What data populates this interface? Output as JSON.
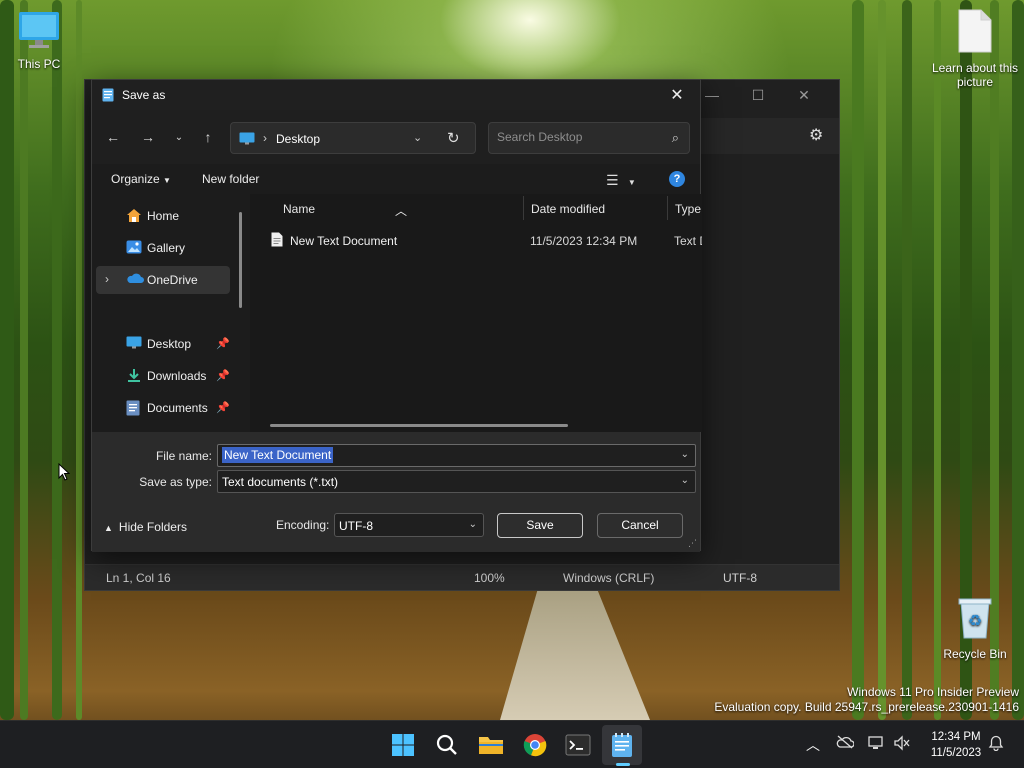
{
  "desktop": {
    "icons": [
      {
        "label": "This PC",
        "icon": "this-pc-icon"
      },
      {
        "label": "Learn about this picture",
        "icon": "text-file-icon"
      },
      {
        "label": "Recycle Bin",
        "icon": "recycle-bin-icon"
      }
    ],
    "watermark": {
      "line1": "Windows 11 Pro Insider Preview",
      "line2": "Evaluation copy. Build 25947.rs_prerelease.230901-1416"
    }
  },
  "notepad": {
    "status": {
      "position": "Ln 1, Col 16",
      "zoom": "100%",
      "line_endings": "Windows (CRLF)",
      "encoding": "UTF-8"
    }
  },
  "dialog": {
    "title": "Save as",
    "address": {
      "location": "Desktop"
    },
    "search": {
      "placeholder": "Search Desktop"
    },
    "commands": {
      "organize": "Organize",
      "new_folder": "New folder"
    },
    "nav": {
      "items": [
        {
          "label": "Home",
          "icon": "home-icon",
          "pinned": false
        },
        {
          "label": "Gallery",
          "icon": "gallery-icon",
          "pinned": false
        },
        {
          "label": "OneDrive",
          "icon": "onedrive-icon",
          "selected": true
        },
        {
          "label": "Desktop",
          "icon": "desktop-folder-icon",
          "pinned": true
        },
        {
          "label": "Downloads",
          "icon": "download-icon",
          "pinned": true
        },
        {
          "label": "Documents",
          "icon": "documents-icon",
          "pinned": true
        }
      ]
    },
    "columns": {
      "name": "Name",
      "date": "Date modified",
      "type": "Type"
    },
    "files": [
      {
        "name": "New Text Document",
        "date": "11/5/2023 12:34 PM",
        "type": "Text D"
      }
    ],
    "form": {
      "file_name_label": "File name:",
      "file_name_value": "New Text Document",
      "type_label": "Save as type:",
      "type_value": "Text documents (*.txt)",
      "hide_folders": "Hide Folders",
      "encoding_label": "Encoding:",
      "encoding_value": "UTF-8",
      "save": "Save",
      "cancel": "Cancel"
    }
  },
  "taskbar": {
    "apps": [
      "start-icon",
      "search-icon",
      "file-explorer-icon",
      "chrome-icon",
      "terminal-icon",
      "notepad-icon"
    ],
    "clock": {
      "time": "12:34 PM",
      "date": "11/5/2023"
    }
  },
  "colors": {
    "accent": "#3b64c8",
    "help": "#2f86e0",
    "taskbar_indicator": "#60cdff"
  }
}
